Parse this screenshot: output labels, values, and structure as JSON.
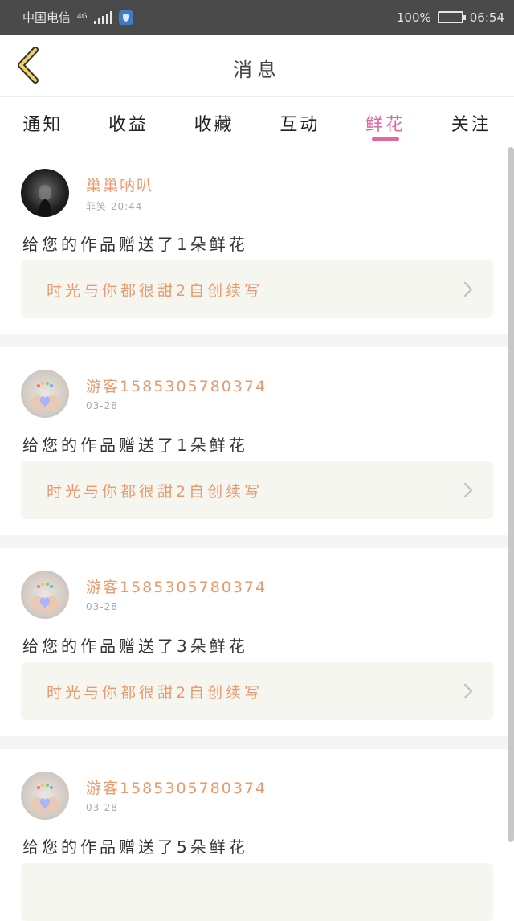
{
  "status_bar": {
    "carrier": "中国电信",
    "network": "4G",
    "battery_percent": "100%",
    "battery_level": 1.0,
    "time": "06:54"
  },
  "header": {
    "title": "消息",
    "back_icon": "chevron-left-icon"
  },
  "tabs": [
    {
      "label": "通知",
      "active": false
    },
    {
      "label": "收益",
      "active": false
    },
    {
      "label": "收藏",
      "active": false
    },
    {
      "label": "互动",
      "active": false
    },
    {
      "label": "鲜花",
      "active": true
    },
    {
      "label": "关注",
      "active": false
    }
  ],
  "colors": {
    "accent_pink": "#e0679f",
    "name_orange": "#e89a6e",
    "box_bg": "#f6f6f1"
  },
  "messages": [
    {
      "username": "巢巢呐叭",
      "meta": "菲笑 20:44",
      "text": "给您的作品赠送了1朵鲜花",
      "work_title": "时光与你都很甜2自创续写",
      "avatar": "dark"
    },
    {
      "username": "游客15853057803​74",
      "meta": "03-28",
      "text": "给您的作品赠送了1朵鲜花",
      "work_title": "时光与你都很甜2自创续写",
      "avatar": "light"
    },
    {
      "username": "游客1585305780374",
      "meta": "03-28",
      "text": "给您的作品赠送了3朵鲜花",
      "work_title": "时光与你都很甜2自创续写",
      "avatar": "light"
    },
    {
      "username": "游客1585305780374",
      "meta": "03-28",
      "text": "给您的作品赠送了5朵鲜花",
      "work_title": "",
      "avatar": "light"
    }
  ]
}
